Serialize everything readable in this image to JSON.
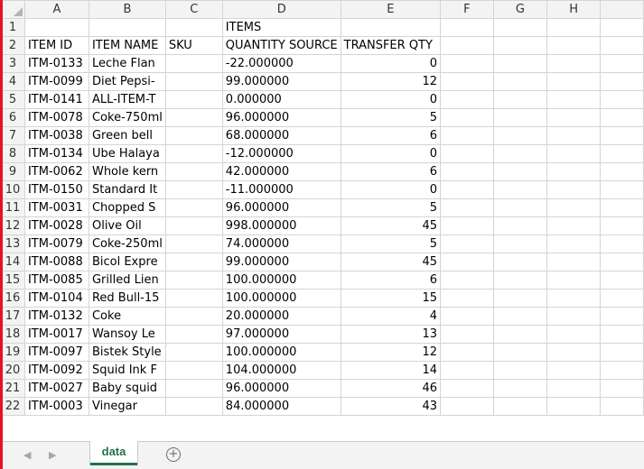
{
  "sheet": {
    "columns": [
      "A",
      "B",
      "C",
      "D",
      "E",
      "F",
      "G",
      "H"
    ],
    "rows": [
      {
        "n": "1",
        "a": "",
        "b": "",
        "c": "",
        "d": "ITEMS",
        "e": ""
      },
      {
        "n": "2",
        "a": "ITEM ID",
        "b": "ITEM NAME",
        "c": "SKU",
        "d": "QUANTITY SOURCE",
        "e": "TRANSFER QTY"
      },
      {
        "n": "3",
        "a": "ITM-0133",
        "b": "Leche Flan",
        "c": "",
        "d": "-22.000000",
        "e": "0"
      },
      {
        "n": "4",
        "a": "ITM-0099",
        "b": "Diet Pepsi-",
        "c": "",
        "d": "99.000000",
        "e": "12"
      },
      {
        "n": "5",
        "a": "ITM-0141",
        "b": "ALL-ITEM-T",
        "c": "",
        "d": "0.000000",
        "e": "0"
      },
      {
        "n": "6",
        "a": "ITM-0078",
        "b": "Coke-750ml",
        "c": "",
        "d": "96.000000",
        "e": "5"
      },
      {
        "n": "7",
        "a": "ITM-0038",
        "b": "Green bell",
        "c": "",
        "d": "68.000000",
        "e": "6"
      },
      {
        "n": "8",
        "a": "ITM-0134",
        "b": "Ube Halaya",
        "c": "",
        "d": "-12.000000",
        "e": "0"
      },
      {
        "n": "9",
        "a": "ITM-0062",
        "b": "Whole kern",
        "c": "",
        "d": "42.000000",
        "e": "6"
      },
      {
        "n": "10",
        "a": "ITM-0150",
        "b": "Standard It",
        "c": "",
        "d": "-11.000000",
        "e": "0"
      },
      {
        "n": "11",
        "a": "ITM-0031",
        "b": "Chopped S",
        "c": "",
        "d": "96.000000",
        "e": "5"
      },
      {
        "n": "12",
        "a": "ITM-0028",
        "b": "Olive Oil",
        "c": "",
        "d": "998.000000",
        "e": "45"
      },
      {
        "n": "13",
        "a": "ITM-0079",
        "b": "Coke-250ml",
        "c": "",
        "d": "74.000000",
        "e": "5"
      },
      {
        "n": "14",
        "a": "ITM-0088",
        "b": "Bicol Expre",
        "c": "",
        "d": "99.000000",
        "e": "45"
      },
      {
        "n": "15",
        "a": "ITM-0085",
        "b": "Grilled Lien",
        "c": "",
        "d": "100.000000",
        "e": "6"
      },
      {
        "n": "16",
        "a": "ITM-0104",
        "b": "Red Bull-15",
        "c": "",
        "d": "100.000000",
        "e": "15"
      },
      {
        "n": "17",
        "a": "ITM-0132",
        "b": "Coke",
        "c": "",
        "d": "20.000000",
        "e": "4"
      },
      {
        "n": "18",
        "a": "ITM-0017",
        "b": "Wansoy Le",
        "c": "",
        "d": "97.000000",
        "e": "13"
      },
      {
        "n": "19",
        "a": "ITM-0097",
        "b": "Bistek Style",
        "c": "",
        "d": "100.000000",
        "e": "12"
      },
      {
        "n": "20",
        "a": "ITM-0092",
        "b": "Squid Ink F",
        "c": "",
        "d": "104.000000",
        "e": "14"
      },
      {
        "n": "21",
        "a": "ITM-0027",
        "b": "Baby squid",
        "c": "",
        "d": "96.000000",
        "e": "46"
      },
      {
        "n": "22",
        "a": "ITM-0003",
        "b": "Vinegar",
        "c": "",
        "d": "84.000000",
        "e": "43"
      }
    ]
  },
  "tabs": {
    "active": "data",
    "prev_arrow": "◀",
    "next_arrow": "▶",
    "add_icon": "+"
  },
  "colors": {
    "accent": "#217346",
    "left_border": "#e81123"
  }
}
